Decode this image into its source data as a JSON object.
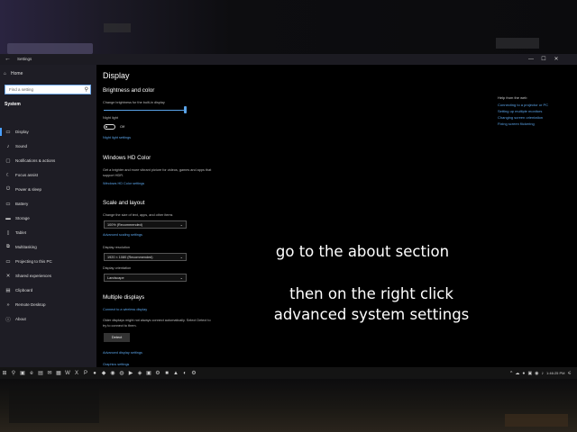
{
  "window": {
    "title": "Settings",
    "back_icon": "←",
    "controls": [
      "—",
      "☐",
      "✕"
    ]
  },
  "sidebar": {
    "home_label": "Home",
    "search_placeholder": "Find a setting",
    "section": "System",
    "items": [
      {
        "icon": "▭",
        "label": "Display",
        "active": true
      },
      {
        "icon": "♪",
        "label": "Sound"
      },
      {
        "icon": "▢",
        "label": "Notifications & actions"
      },
      {
        "icon": "☾",
        "label": "Focus assist"
      },
      {
        "icon": "⏻",
        "label": "Power & sleep"
      },
      {
        "icon": "▭",
        "label": "Battery"
      },
      {
        "icon": "▬",
        "label": "Storage"
      },
      {
        "icon": "▯",
        "label": "Tablet"
      },
      {
        "icon": "⧉",
        "label": "Multitasking"
      },
      {
        "icon": "▭",
        "label": "Projecting to this PC"
      },
      {
        "icon": "✕",
        "label": "Shared experiences"
      },
      {
        "icon": "▤",
        "label": "Clipboard"
      },
      {
        "icon": "»",
        "label": "Remote Desktop"
      },
      {
        "icon": "ⓘ",
        "label": "About"
      }
    ]
  },
  "main": {
    "title": "Display",
    "brightness": {
      "heading": "Brightness and color",
      "desc": "Change brightness for the built-in display",
      "value_fraction": 1.0,
      "night_light_label": "Night light",
      "night_light_state": "Off",
      "night_light_link": "Night light settings"
    },
    "hd": {
      "heading": "Windows HD Color",
      "desc1": "Get a brighter and more vibrant picture for videos, games and apps that",
      "desc2": "support HDR.",
      "link": "Windows HD Color settings"
    },
    "scale": {
      "heading": "Scale and layout",
      "size_label": "Change the size of text, apps, and other items",
      "size_value": "100% (Recommended)",
      "advanced_link": "Advanced scaling settings",
      "resolution_label": "Display resolution",
      "resolution_value": "1920 × 1080 (Recommended)",
      "orientation_label": "Display orientation",
      "orientation_value": "Landscape"
    },
    "multi": {
      "heading": "Multiple displays",
      "wireless_link": "Connect to a wireless display",
      "desc1": "Older displays might not always connect automatically. Select Detect to",
      "desc2": "try to connect to them.",
      "detect_button": "Detect",
      "advanced_link": "Advanced display settings",
      "graphics_link": "Graphics settings"
    }
  },
  "help": {
    "title": "Help from the web",
    "links": [
      "Connecting to a projector or PC",
      "Setting up multiple monitors",
      "Changing screen orientation",
      "Fixing screen flickering"
    ]
  },
  "overlay": {
    "line1": "go to the about section",
    "line2": "then on the right click",
    "line3": "advanced system settings"
  },
  "taskbar": {
    "icons": [
      "⊞",
      "⚲",
      "▣",
      "e",
      "▤",
      "✉",
      "▦",
      "W",
      "X",
      "P",
      "●",
      "◆",
      "◉",
      "◍",
      "▶",
      "◈",
      "▣",
      "⚙",
      "■",
      "▲",
      "◐",
      "⚙"
    ],
    "tray": [
      "^",
      "☁",
      "●",
      "▣",
      "◉",
      "♪",
      "⚟"
    ],
    "clock": "1:46:25 PM"
  }
}
